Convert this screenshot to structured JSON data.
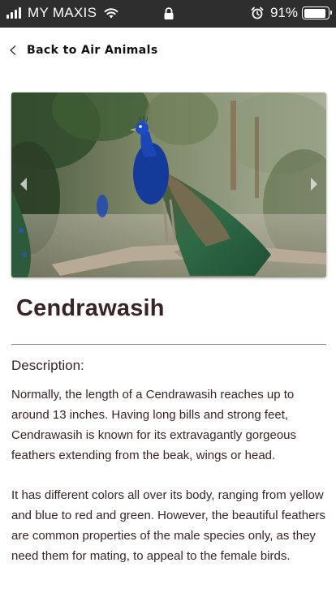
{
  "status_bar": {
    "carrier": "MY MAXIS",
    "battery_percent": "91%",
    "battery_level": 0.91,
    "icons": [
      "signal-icon",
      "wifi-icon",
      "lock-icon",
      "alarm-icon",
      "battery-icon"
    ]
  },
  "nav": {
    "back_label": "Back to Air Animals",
    "back_icon": "chevron-left-icon"
  },
  "hero": {
    "image": "peacock-photo",
    "prev_icon": "arrow-left-icon",
    "next_icon": "arrow-right-icon"
  },
  "animal": {
    "name": "Cendrawasih",
    "description_label": "Description:",
    "paragraphs": [
      "Normally, the length of a Cendrawasih reaches up to around 13 inches. Having long bills and strong feet, Cendrawasih is known for its extravagantly gorgeous feathers extending from the beak, wings or head.",
      "It has different colors all over its body, ranging from yellow and blue to red and green. However, the beautiful feathers are common properties of the male species only, as they need them for mating, to appeal to the female birds."
    ]
  },
  "colors": {
    "status_bar_bg": "#2e2e2e",
    "text": "#3a2323",
    "divider": "#8a8080"
  }
}
